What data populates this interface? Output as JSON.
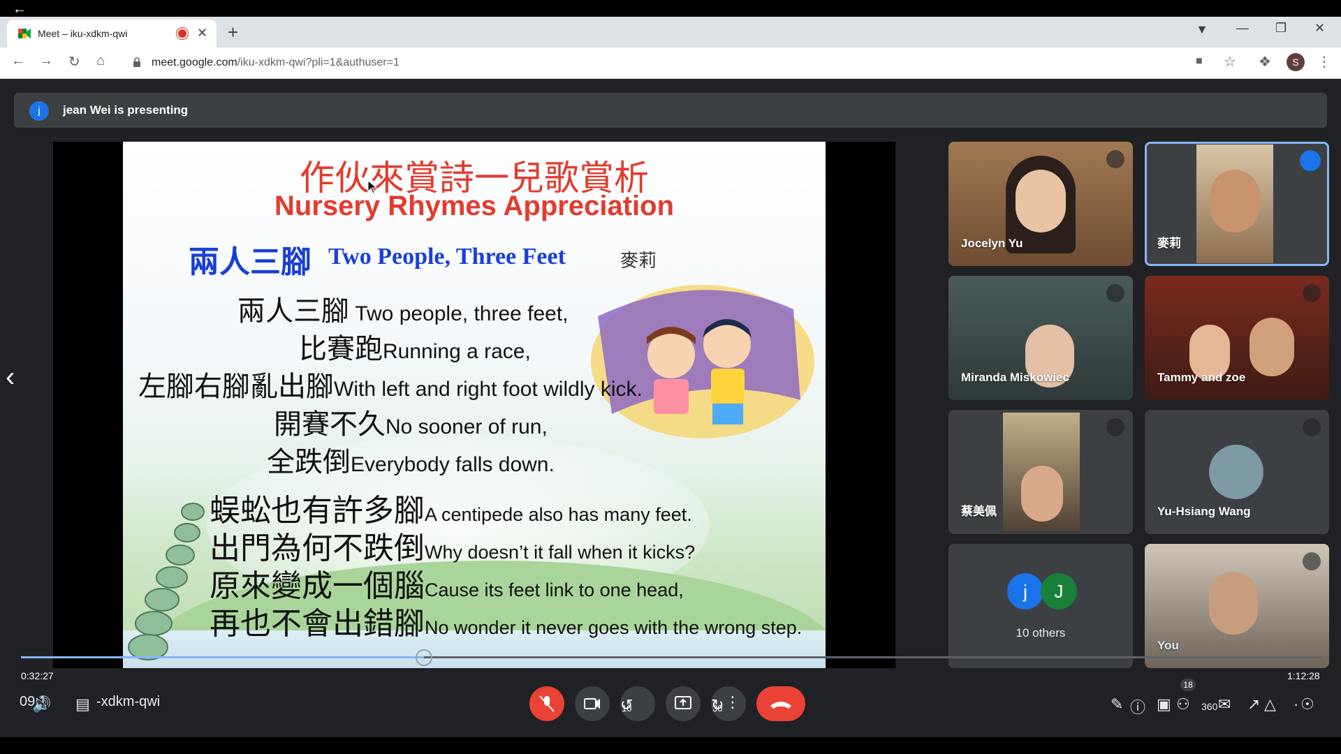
{
  "tab": {
    "title": "Meet – iku-xdkm-qwi"
  },
  "address": {
    "host": "meet.google.com",
    "path": "/iku-xdkm-qwi?pli=1&authuser=1"
  },
  "profile": {
    "initial": "S"
  },
  "banner": {
    "avatar": "j",
    "text": "jean Wei is presenting"
  },
  "slide": {
    "title_zh": "作伙來賞詩一兒歌賞析",
    "title_en": "Nursery Rhymes Appreciation",
    "subtitle_zh": "兩人三腳",
    "subtitle_en": "Two People, Three Feet",
    "author": "麥莉",
    "lines": [
      {
        "zh": "兩人三腳",
        "en": " Two people, three feet,"
      },
      {
        "zh": "比賽跑",
        "en": "Running a race,"
      },
      {
        "zh": "左腳右腳亂出腳",
        "en": "With left and right foot wildly kick."
      },
      {
        "zh": "開賽不久",
        "en": "No sooner of run,"
      },
      {
        "zh": "全跌倒",
        "en": "Everybody falls down."
      },
      {
        "zh": "蜈蚣也有許多腳",
        "en": "A centipede also has many feet."
      },
      {
        "zh": "出門為何不跌倒",
        "en": "Why doesn’t it fall when it kicks?"
      },
      {
        "zh": "原來變成一個腦",
        "en": "Cause its feet link to one head,"
      },
      {
        "zh": "再也不會出錯腳",
        "en": "No wonder it never goes with the wrong step."
      }
    ]
  },
  "participants": [
    {
      "name": "Jocelyn Yu",
      "muted": true
    },
    {
      "name": "麥莉",
      "muted": false,
      "speaking": true
    },
    {
      "name": "Miranda Miskowiec",
      "muted": true
    },
    {
      "name": "Tammy and zoe",
      "muted": true
    },
    {
      "name": "蔡美佩",
      "muted": true
    },
    {
      "name": "Yu-Hsiang Wang",
      "muted": true
    },
    {
      "name": "You",
      "muted": true
    }
  ],
  "others": {
    "avatars": [
      "j",
      "J"
    ],
    "label": "10 others"
  },
  "player": {
    "elapsed": "0:32:27",
    "total": "1:12:28",
    "progress": 0.31
  },
  "meeting": {
    "clock": "09:1",
    "code": "-xdkm-qwi"
  },
  "controls": {
    "rewind_label": "10",
    "forward_label": "30",
    "people_count": "18",
    "vr_label": "360"
  },
  "colors": {
    "accent": "#8ab4f8",
    "danger": "#ea4335",
    "slide_red": "#e23b2e",
    "slide_blue": "#1a3fd6"
  }
}
